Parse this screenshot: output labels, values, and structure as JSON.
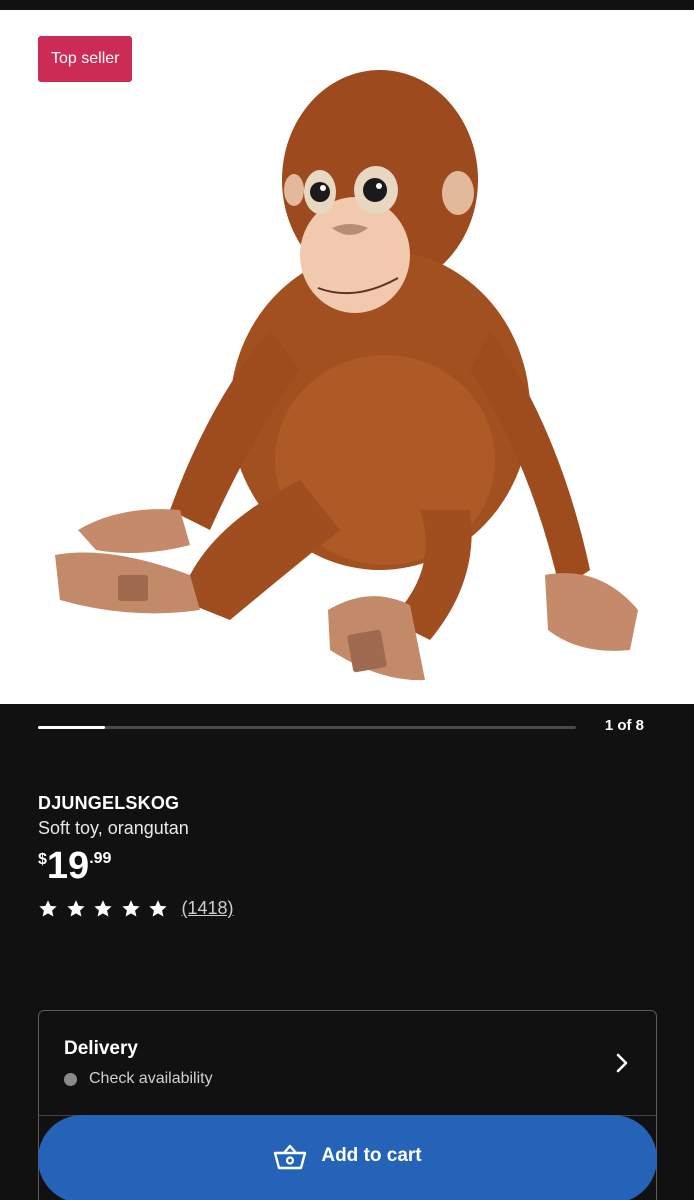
{
  "product": {
    "badge": "Top seller",
    "name": "DJUNGELSKOG",
    "description": "Soft toy, orangutan",
    "price": {
      "currency": "$",
      "whole": "19",
      "fraction": ".99"
    },
    "rating": {
      "stars": 5,
      "review_count": "(1418)"
    }
  },
  "gallery": {
    "counter": "1 of 8",
    "current": 1,
    "total": 8
  },
  "delivery": {
    "title": "Delivery",
    "status": "Check availability"
  },
  "cart": {
    "button_label": "Add to cart"
  },
  "colors": {
    "badge": "#cc2b55",
    "button": "#2563b8",
    "background": "#111111"
  },
  "icons": {
    "cart": "basket-icon",
    "chevron": "chevron-right-icon",
    "star": "star-icon"
  }
}
